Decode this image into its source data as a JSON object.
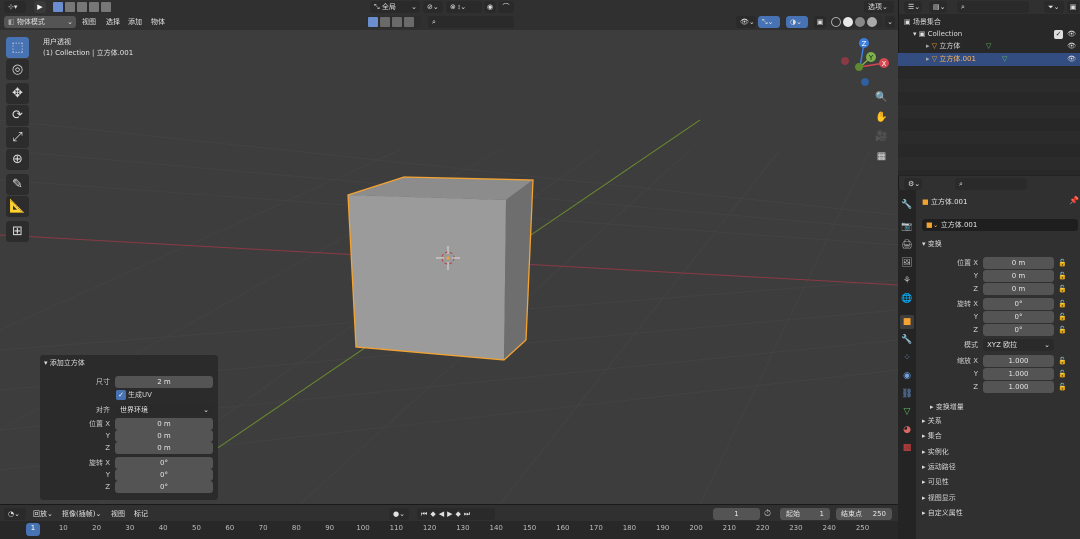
{
  "viewport_header": {
    "mode": "物体模式",
    "menus": [
      "视图",
      "选择",
      "添加",
      "物体"
    ],
    "orientation": "全局",
    "options": "选项"
  },
  "viewport": {
    "view_name": "用户透视",
    "collection_info": "(1) Collection | 立方体.001",
    "gizmo_axes": [
      "X",
      "Y",
      "Z"
    ]
  },
  "redo_panel": {
    "title": "添加立方体",
    "size_label": "尺寸",
    "size_value": "2 m",
    "generate_uv": "生成UV",
    "align_label": "对齐",
    "align_value": "世界环境",
    "location_label": "位置 X",
    "location": [
      "0 m",
      "0 m",
      "0 m"
    ],
    "rotation_label": "旋转 X",
    "rotation": [
      "0°",
      "0°",
      "0°"
    ],
    "axis_y": "Y",
    "axis_z": "Z"
  },
  "timeline": {
    "menus": [
      "回放",
      "抠像(插帧)",
      "视图",
      "标记"
    ],
    "current_frame": "1",
    "start_label": "起始",
    "start": "1",
    "end_label": "结束点",
    "end": "250",
    "ruler": [
      "1",
      "10",
      "20",
      "30",
      "40",
      "50",
      "60",
      "70",
      "80",
      "90",
      "100",
      "110",
      "120",
      "130",
      "140",
      "150",
      "160",
      "170",
      "180",
      "190",
      "200",
      "210",
      "220",
      "230",
      "240",
      "250"
    ]
  },
  "outliner": {
    "scene_collection": "场景集合",
    "collection": "Collection",
    "items": [
      "立方体",
      "立方体.001"
    ]
  },
  "properties": {
    "object_name": "立方体.001",
    "datablock_name": "立方体.001",
    "transform_title": "变换",
    "location_label": "位置 X",
    "location": [
      "0 m",
      "0 m",
      "0 m"
    ],
    "rotation_label": "旋转 X",
    "rotation": [
      "0°",
      "0°",
      "0°"
    ],
    "mode_label": "模式",
    "mode_value": "XYZ 欧拉",
    "scale_label": "缩放 X",
    "scale": [
      "1.000",
      "1.000",
      "1.000"
    ],
    "axis_y": "Y",
    "axis_z": "Z",
    "delta_transform": "变换增量",
    "sections": [
      "关系",
      "集合",
      "实例化",
      "运动路径",
      "可见性",
      "视图显示",
      "自定义属性"
    ]
  }
}
